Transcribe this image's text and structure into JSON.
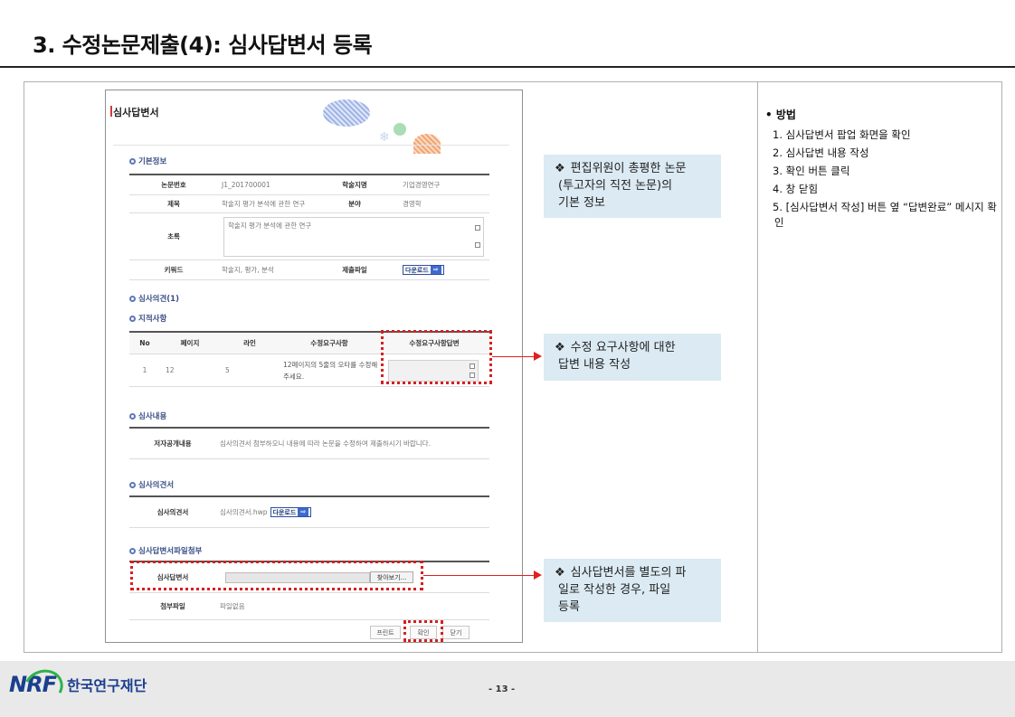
{
  "slide": {
    "title": "3. 수정논문제출(4): 심사답변서 등록",
    "page_number": "- 13 -",
    "org_logo_text": "NRF",
    "org_name": "한국연구재단"
  },
  "popup": {
    "title": "심사답변서",
    "basic_info": {
      "heading": "기본정보",
      "paper_no_label": "논문번호",
      "paper_no": "J1_201700001",
      "journal_label": "학술지명",
      "journal": "기업경영연구",
      "subject_label": "제목",
      "subject": "학술지 평가 분석에 관한 연구",
      "field_label": "분야",
      "field": "경영학",
      "abstract_label": "초록",
      "abstract": "학술지 평가 분석에 관한 연구",
      "keyword_label": "키워드",
      "keyword": "학술지, 평가, 분석",
      "file_label": "제출파일",
      "download": "다운로드"
    },
    "opinion_heading": "심사의견(1)",
    "points": {
      "heading": "지적사항",
      "headers": [
        "No",
        "페이지",
        "라인",
        "수정요구사항",
        "수정요구사항답변"
      ],
      "row": {
        "no": "1",
        "page": "12",
        "line": "5",
        "request_1": "12페이지의 5줄의 오타를 수정해",
        "request_2": "주세요."
      }
    },
    "review_content": {
      "heading": "심사내용",
      "label": "저자공개내용",
      "text": "심사의견서 첨부하오니 내용에 따라 논문을 수정하여 제출하시기 바랍니다."
    },
    "review_opinion": {
      "heading": "심사의견서",
      "label": "심사의견서",
      "file": "심사의견서.hwp",
      "download": "다운로드"
    },
    "answer_file": {
      "heading": "심사답변서파일첨부",
      "label": "심사답변서",
      "browse": "찾아보기...",
      "attach_label": "첨부파일",
      "attach_value": "파일없음"
    },
    "buttons": {
      "print": "프린트",
      "confirm": "확인",
      "close": "닫기"
    }
  },
  "callouts": {
    "c1": "편집위원이 총평한 논문 (투고자의 직전 논문)의 기본 정보",
    "c1_l1": "편집위원이 총평한 논문",
    "c1_l2": "(투고자의 직전 논문)의",
    "c1_l3": "기본 정보",
    "c2_l1": "수정 요구사항에 대한",
    "c2_l2": "답변 내용 작성",
    "c3_l1": "심사답변서를 별도의 파",
    "c3_l2": "일로 작성한 경우, 파일",
    "c3_l3": "등록",
    "bullet": "❖"
  },
  "method": {
    "heading": "• 방법",
    "steps": [
      "1. 심사답변서 팝업 화면을 확인",
      "2. 심사답변 내용 작성",
      "3. 확인 버튼 클릭",
      "4. 창 닫힘",
      "5. [심사답변서 작성] 버튼 옆 “답변완료” 메시지 확인"
    ]
  },
  "colors": {
    "highlight": "#d71f1f",
    "callout_bg": "#dbeaf3",
    "accent": "#1b3f8f"
  }
}
